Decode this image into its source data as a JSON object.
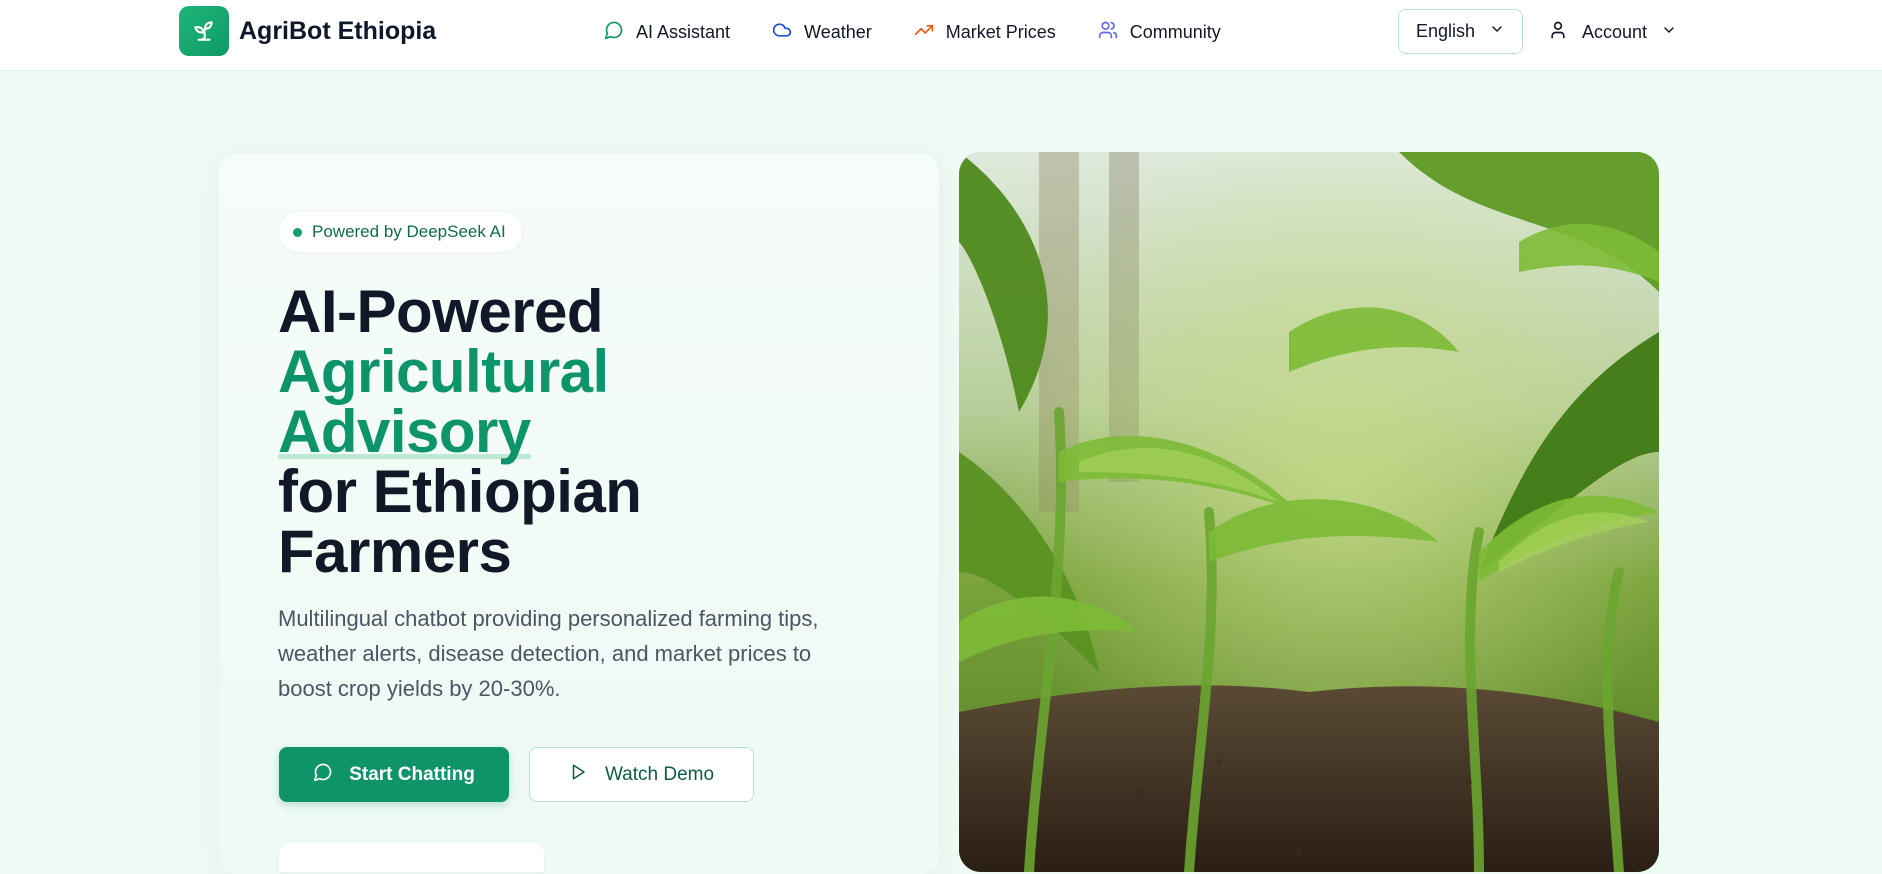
{
  "brand": {
    "name": "AgriBot Ethiopia",
    "logo_icon": "sprout-icon"
  },
  "nav": {
    "items": [
      {
        "label": "AI Assistant",
        "icon": "chat-bubble-icon",
        "color": "#0f946a"
      },
      {
        "label": "Weather",
        "icon": "cloud-icon",
        "color": "#1d4ed8"
      },
      {
        "label": "Market Prices",
        "icon": "trending-up-icon",
        "color": "#ea580c"
      },
      {
        "label": "Community",
        "icon": "users-icon",
        "color": "#6366f1"
      }
    ]
  },
  "language": {
    "selected": "English"
  },
  "account": {
    "label": "Account"
  },
  "hero": {
    "badge": "Powered by DeepSeek AI",
    "headline": {
      "line1": "AI-Powered",
      "line2": "Agricultural",
      "line3": "Advisory",
      "line4": "for Ethiopian",
      "line5": "Farmers"
    },
    "description": "Multilingual chatbot providing personalized farming tips, weather alerts, disease detection, and market prices to boost crop yields by 20-30%.",
    "primary_button": "Start Chatting",
    "secondary_button": "Watch Demo"
  },
  "image": {
    "subject": "young-maize-field-photo"
  },
  "colors": {
    "accent": "#0f946a",
    "background": "#eefaf4",
    "text": "#111827"
  }
}
